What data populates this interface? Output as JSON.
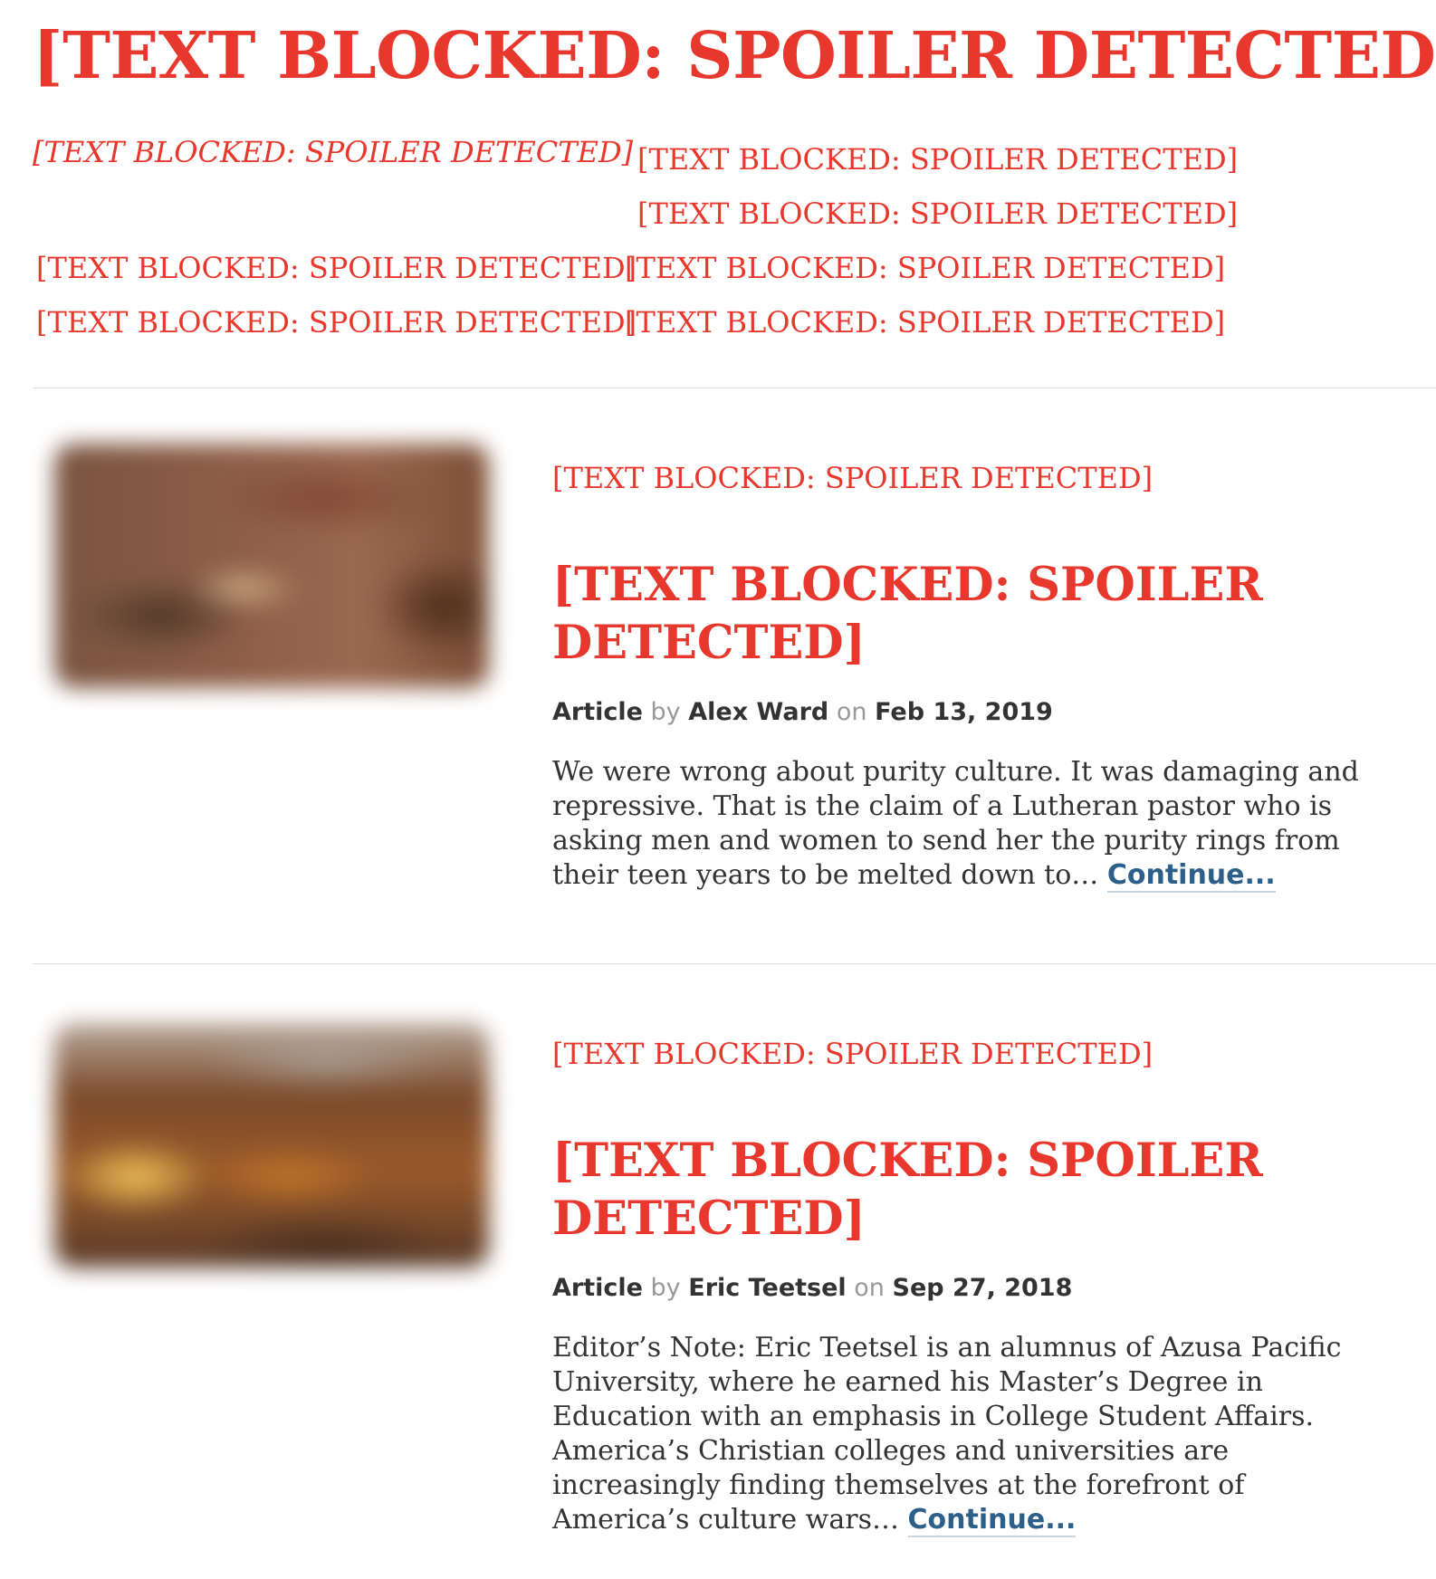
{
  "page": {
    "title": "[TEXT BLOCKED: SPOILER DETECTED]",
    "subtitle_left": "[TEXT BLOCKED: SPOILER DETECTED]",
    "blocked_lines": {
      "right_1": "[TEXT BLOCKED: SPOILER DETECTED]",
      "right_2": "[TEXT BLOCKED: SPOILER DETECTED]",
      "row3_left": "[TEXT BLOCKED: SPOILER DETECTED]",
      "row3_right": "[TEXT BLOCKED: SPOILER DETECTED]",
      "row4_left": "[TEXT BLOCKED: SPOILER DETECTED]",
      "row4_right": "[TEXT BLOCKED: SPOILER DETECTED]"
    }
  },
  "colors": {
    "accent": "#e8382d",
    "link": "#2d5f8b",
    "text": "#333333",
    "muted": "#999999"
  },
  "articles": [
    {
      "kicker": "[TEXT BLOCKED: SPOILER DETECTED]",
      "headline": "[TEXT BLOCKED: SPOILER DETECTED]",
      "type": "Article",
      "by_label": "by",
      "author": "Alex Ward",
      "on_label": "on",
      "date": "Feb 13, 2019",
      "excerpt": "We were wrong about purity culture. It was damaging and repressive. That is the claim of a Lutheran pastor who is asking men and women to send her the purity rings from their teen years to be melted down to… ",
      "continue_label": "Continue..."
    },
    {
      "kicker": "[TEXT BLOCKED: SPOILER DETECTED]",
      "headline": "[TEXT BLOCKED: SPOILER DETECTED]",
      "type": "Article",
      "by_label": "by",
      "author": "Eric Teetsel",
      "on_label": "on",
      "date": "Sep 27, 2018",
      "excerpt": "Editor’s Note: Eric Teetsel is an alumnus of Azusa Pacific University, where he earned his Master’s Degree in Education with an emphasis in College Student Affairs. America’s Christian colleges and universities are increasingly finding themselves at the forefront of America’s culture wars… ",
      "continue_label": "Continue..."
    }
  ]
}
